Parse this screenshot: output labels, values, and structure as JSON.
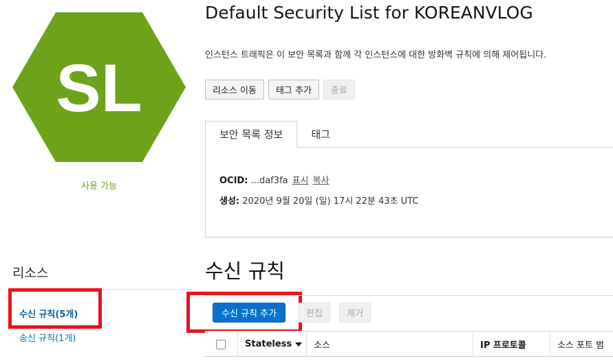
{
  "resource": {
    "badge_text": "SL",
    "badge_color": "#6fa21b",
    "status": "사용 가능",
    "title": "Default Security List for KOREANVLOG",
    "description": "인스턴스 트래픽은 이 보안 목록과 함께 각 인스턴스에 대한 방화벽 규칙에 의해 제어됩니다."
  },
  "actions": {
    "move": "리소스 이동",
    "add_tag": "태그 추가",
    "terminate": "종료"
  },
  "tabs": {
    "info": "보안 목록 정보",
    "tags": "태그"
  },
  "info": {
    "ocid_label": "OCID:",
    "ocid_value": "...daf3fa",
    "show_link": "표시",
    "copy_link": "복사",
    "created_label": "생성:",
    "created_value": "2020년 9월 20일 (일) 17시 22분 43초 UTC"
  },
  "sidebar": {
    "title": "리소스",
    "items": [
      {
        "label": "수신 규칙",
        "count": "(5개)"
      },
      {
        "label": "송신 규칙",
        "count": "(1개)"
      }
    ]
  },
  "ingress": {
    "title": "수신 규칙",
    "add_button": "수신 규칙 추가",
    "edit_button": "편집",
    "remove_button": "제거",
    "columns": [
      "Stateless",
      "소스",
      "IP 프로토콜",
      "소스 포트 범"
    ]
  },
  "colors": {
    "accent": "#0572ce",
    "highlight": "#e8131c",
    "status": "#6fa21b"
  }
}
